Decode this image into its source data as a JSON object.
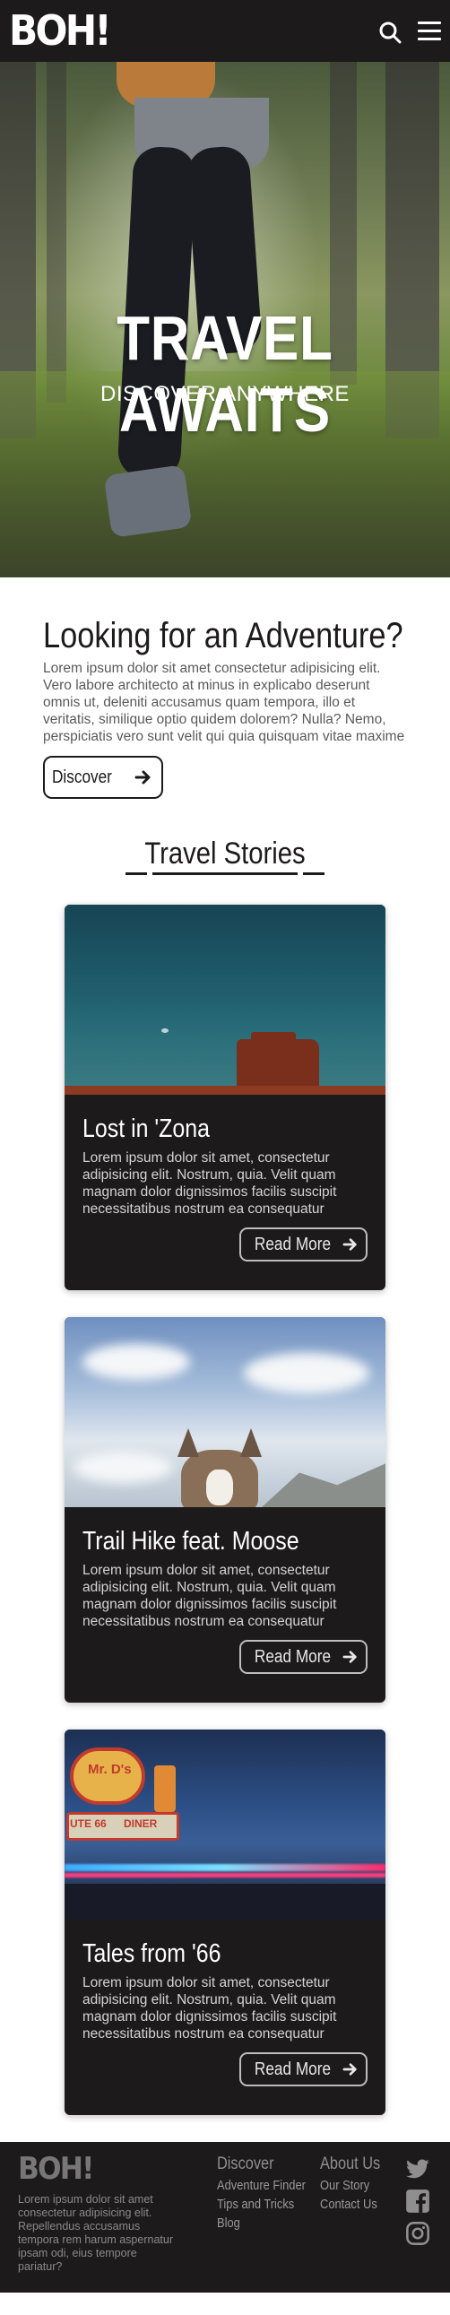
{
  "brand": {
    "logo": "BOH!"
  },
  "hero": {
    "title": "TRAVEL AWAITS",
    "subtitle": "DISCOVER ANYWHERE"
  },
  "intro": {
    "heading": "Looking for an Adventure?",
    "body": "Lorem ipsum dolor sit amet consectetur adipisicing elit. Vero labore architecto at minus in explicabo deserunt omnis ut, deleniti accusamus quam tempora, illo et veritatis, similique optio quidem dolorem? Nulla? Nemo, perspiciatis vero sunt velit qui quia quisquam vitae maxime",
    "button_label": "Discover"
  },
  "stories": {
    "heading": "Travel Stories",
    "read_more_label": "Read More",
    "cards": [
      {
        "title": "Lost in 'Zona",
        "text": "Lorem ipsum dolor sit amet, consectetur adipisicing elit. Nostrum, quia. Velit quam magnam dolor dignissimos facilis suscipit necessitatibus nostrum ea consequatur"
      },
      {
        "title": "Trail Hike feat. Moose",
        "text": "Lorem ipsum dolor sit amet, consectetur adipisicing elit. Nostrum, quia. Velit quam magnam dolor dignissimos facilis suscipit necessitatibus nostrum ea consequatur"
      },
      {
        "title": "Tales from '66",
        "text": "Lorem ipsum dolor sit amet, consectetur adipisicing elit. Nostrum, quia. Velit quam magnam dolor dignissimos facilis suscipit necessitatibus nostrum ea consequatur"
      }
    ]
  },
  "sign": {
    "top": "Mr. D's",
    "route": "UTE 66",
    "diner": "DINER"
  },
  "footer": {
    "logo": "BOH!",
    "text": "Lorem ipsum dolor sit amet consectetur adipisicing elit. Repellendus accusamus tempora rem harum aspernatur ipsam odi, eius tempore pariatur?",
    "discover": {
      "heading": "Discover",
      "links": [
        "Adventure Finder",
        "Tips and Tricks",
        "Blog"
      ]
    },
    "about": {
      "heading": "About Us",
      "links": [
        "Our Story",
        "Contact Us"
      ]
    },
    "social": [
      "twitter-icon",
      "facebook-icon",
      "instagram-icon"
    ]
  },
  "colors": {
    "dark": "#1c1a1b",
    "white": "#ffffff"
  }
}
